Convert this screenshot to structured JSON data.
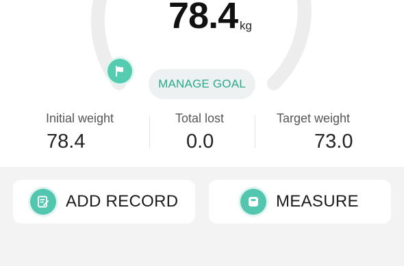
{
  "weight": {
    "value": "78.4",
    "unit": "kg"
  },
  "goal": {
    "manage_label": "MANAGE GOAL",
    "flag_icon": "flag-icon"
  },
  "stats": {
    "initial": {
      "label": "Initial weight",
      "value": "78.4"
    },
    "lost": {
      "label": "Total lost",
      "value": "0.0"
    },
    "target": {
      "label": "Target weight",
      "value": "73.0"
    }
  },
  "actions": {
    "add_record": {
      "label": "ADD RECORD",
      "icon": "edit-record-icon"
    },
    "measure": {
      "label": "MEASURE",
      "icon": "scale-icon"
    }
  },
  "colors": {
    "accent": "#52c6ae",
    "accent_text": "#27a98d",
    "gauge_track": "#ededed"
  }
}
